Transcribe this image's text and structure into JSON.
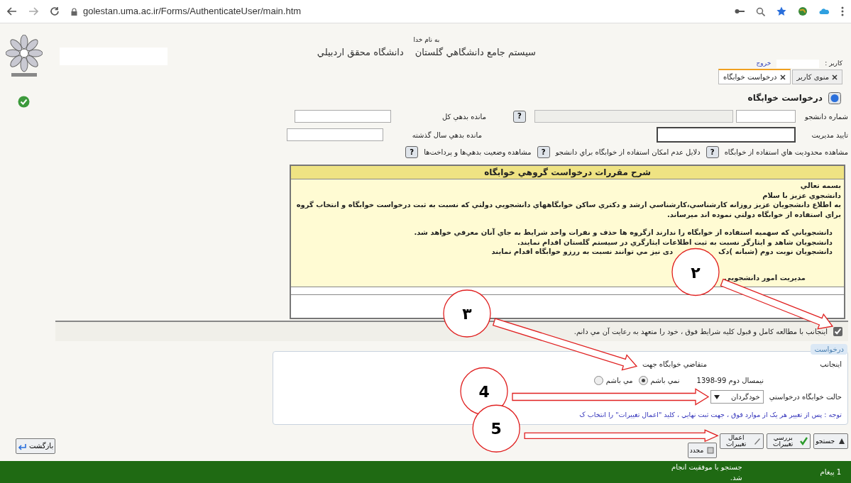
{
  "browser": {
    "url": "golestan.uma.ac.ir/Forms/AuthenticateUser/main.htm"
  },
  "header": {
    "bismillah": "به نام خدا",
    "system_name": "سيستم جامع دانشگاهي گلستان",
    "university": "دانشگاه محقق اردبيلي",
    "user_label": "کاربر :",
    "logout": "خروج"
  },
  "tabs": [
    {
      "label": "منوی کاربر",
      "selected": false
    },
    {
      "label": "درخواست خوابگاه",
      "selected": true
    }
  ],
  "page_title": "درخواست خوابگاه",
  "fields": [
    {
      "label": "شماره دانشجو",
      "help": "?"
    },
    {
      "label": "مانده بدهي کل"
    },
    {
      "label": "تاييد مديريت"
    },
    {
      "label": "مانده بدهي سال گذشته"
    }
  ],
  "links": [
    {
      "text": "مشاهده محدوديت هاي استفاده از خوابگاه",
      "help": "?"
    },
    {
      "text": "دلايل عدم امکان استفاده از خوابگاه براي دانشجو",
      "help": "?"
    },
    {
      "text": "مشاهده وضعيت بدهي‌ها و پرداخت‌ها",
      "help": "?"
    }
  ],
  "rules": {
    "title": "شرح مقررات درخواست گروهي خوابگاه",
    "greeting": [
      "بسمه تعالي",
      "دانشجوي عزيز با سلام"
    ],
    "notice": "به اطلاع دانشجويان عزيز روزانه کارشناسي،کارشناسي ارشد و دکتري ساکن خوابگاههاي دانشجويي دولتي که نسبت به ثبت درخواست خوابگاه و انتخاب گروه براي استفاده از خوابگاه دولتي نموده اند ميرساند.",
    "items": [
      [
        "دانشجوياني که سهميه استفاده از خوابگاه را ندارند ازگروه ها حذف و نفرات واحد شرايط به جاي آنان معرفي خواهد شد."
      ],
      [
        "دانشجويان شاهد و ايثارگر نسبت به ثبت اطلاعات ايثارگري در سيستم گلستان اقدام نمايند."
      ],
      [
        "دانشجويان نوبت دوم (شبانه )دک",
        "دی  نيز مي توانند نسبت به ررزو خوابگاه اقدام نمايند"
      ]
    ],
    "signature": "مديريت امور دانشجويي"
  },
  "agreement": {
    "text": "اينجانب با مطالعه کامل و قبول کليه شرايط فوق ، خود را متعهد به رعايت آن مي دانم.",
    "checked": true
  },
  "request": {
    "legend": "درخواست",
    "subject": "اينجانب",
    "applicant_label": "متقاضي خوابگاه جهت",
    "term": "نيمسال دوم 99-1398",
    "options": [
      {
        "label": "نمي باشم",
        "selected": true
      },
      {
        "label": "مي باشم",
        "selected": false
      }
    ],
    "mode_label": "حالت خوابگاه درخواستي",
    "mode_value": "خودگردان",
    "note": "توجه : پس از تغيير هر يک از موارد فوق ، جهت ثبت نهايي ، کليد \"اعمال تغييرات\" را انتخاب ک"
  },
  "buttons": [
    {
      "kind": "search",
      "label": "جستجو"
    },
    {
      "kind": "review",
      "label": "بررسي تغييرات"
    },
    {
      "kind": "apply",
      "label": "اعمال تغييرات"
    },
    {
      "kind": "reset",
      "label": "مجدد"
    }
  ],
  "back_button": "بازگشت",
  "status_bar": {
    "count": "1 پيغام",
    "message": "جستجو با موفقيت انجام شد."
  },
  "annotations": [
    {
      "label": "۲"
    },
    {
      "label": "۳"
    },
    {
      "label": "4"
    },
    {
      "label": "5"
    }
  ]
}
